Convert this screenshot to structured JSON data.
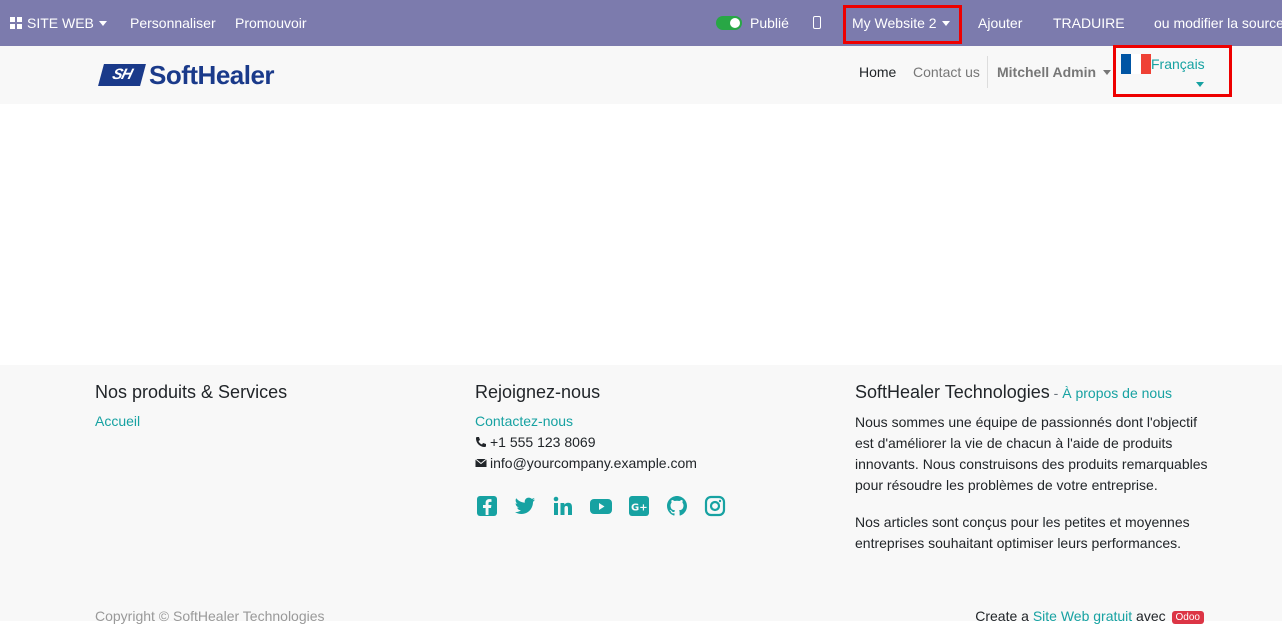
{
  "adminbar": {
    "site_menu": "SITE WEB",
    "customize": "Personnaliser",
    "promote": "Promouvoir",
    "published": "Publié",
    "website_selector": "My Website 2",
    "add": "Ajouter",
    "translate": "TRADUIRE",
    "edit_source": "ou modifier la source"
  },
  "header": {
    "logo_mark": "SH",
    "logo_text": "SoftHealer",
    "nav_home": "Home",
    "nav_contact": "Contact us",
    "user": "Mitchell Admin",
    "language": "Français"
  },
  "footer": {
    "col1": {
      "title": "Nos produits & Services",
      "link": "Accueil"
    },
    "col2": {
      "title": "Rejoignez-nous",
      "contact_link": "Contactez-nous",
      "phone": "+1 555 123 8069",
      "email": "info@yourcompany.example.com",
      "social_icons": [
        "facebook-icon",
        "twitter-icon",
        "linkedin-icon",
        "youtube-icon",
        "google-plus-icon",
        "github-icon",
        "instagram-icon"
      ]
    },
    "col3": {
      "title": "SoftHealer Technologies",
      "title_sep": " - ",
      "about_link": "À propos de nous",
      "para1": "Nous sommes une équipe de passionnés dont l'objectif est d'améliorer la vie de chacun à l'aide de produits innovants. Nous construisons des produits remarquables pour résoudre les problèmes de votre entreprise.",
      "para2": "Nos articles sont conçus pour les petites et moyennes entreprises souhaitant optimiser leurs performances."
    },
    "copyright": "Copyright © SoftHealer Technologies",
    "create_prefix": "Create a ",
    "create_link": "Site Web gratuit",
    "create_mid": " avec ",
    "odoo_badge": "Odoo"
  },
  "colors": {
    "adminbar_bg": "#7c7bad",
    "accent": "#17a2a2",
    "highlight": "#e00000",
    "logo": "#1a3a8a"
  }
}
